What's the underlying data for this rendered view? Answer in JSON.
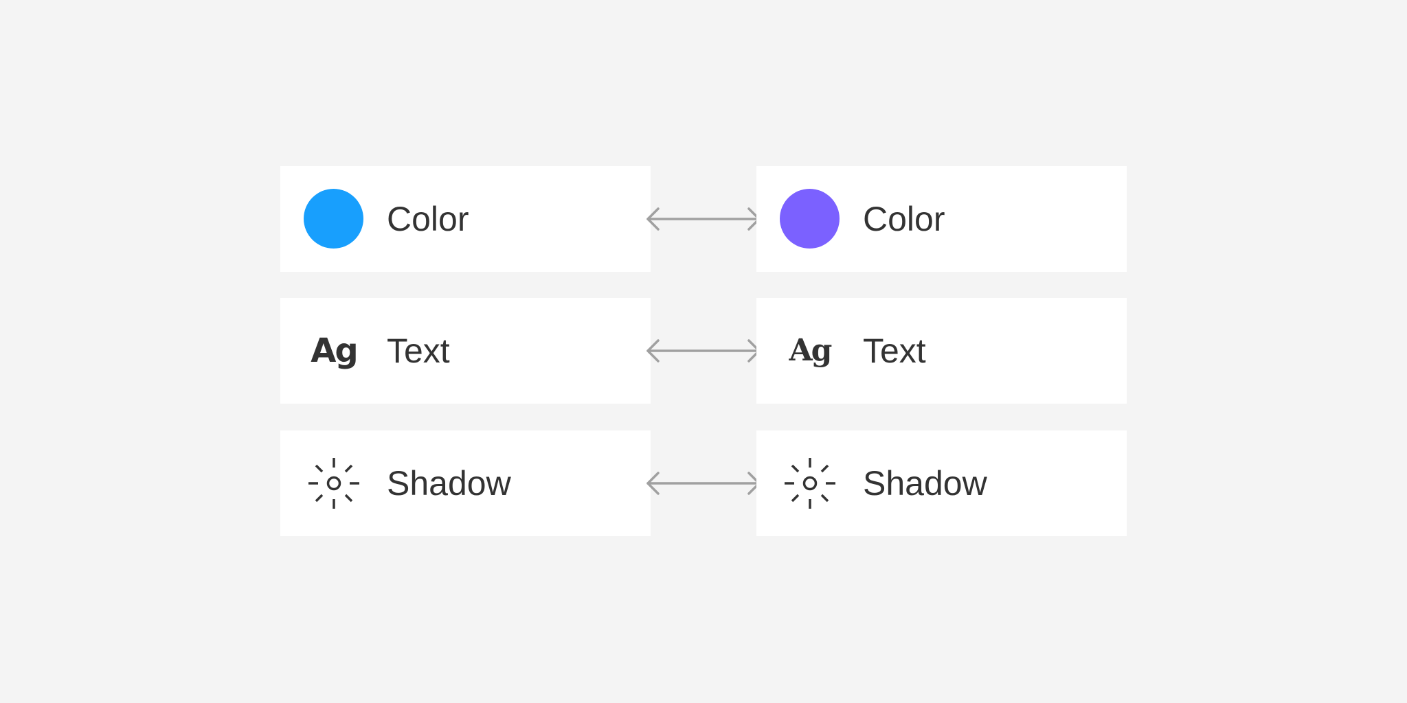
{
  "rows": [
    {
      "left": {
        "icon": "color-swatch-icon",
        "label": "Color",
        "color": "#189FFD"
      },
      "right": {
        "icon": "color-swatch-icon",
        "label": "Color",
        "color": "#7B61FF"
      }
    },
    {
      "left": {
        "icon": "text-style-icon",
        "glyph": "Ag",
        "label": "Text"
      },
      "right": {
        "icon": "text-style-icon",
        "glyph": "Ag",
        "label": "Text"
      }
    },
    {
      "left": {
        "icon": "sun-shadow-icon",
        "label": "Shadow"
      },
      "right": {
        "icon": "sun-shadow-icon",
        "label": "Shadow"
      }
    }
  ],
  "connector": {
    "icon": "double-arrow-icon",
    "color": "#A0A0A0"
  },
  "colors": {
    "background": "#F4F4F4",
    "card": "#FFFFFF",
    "text": "#333333"
  }
}
